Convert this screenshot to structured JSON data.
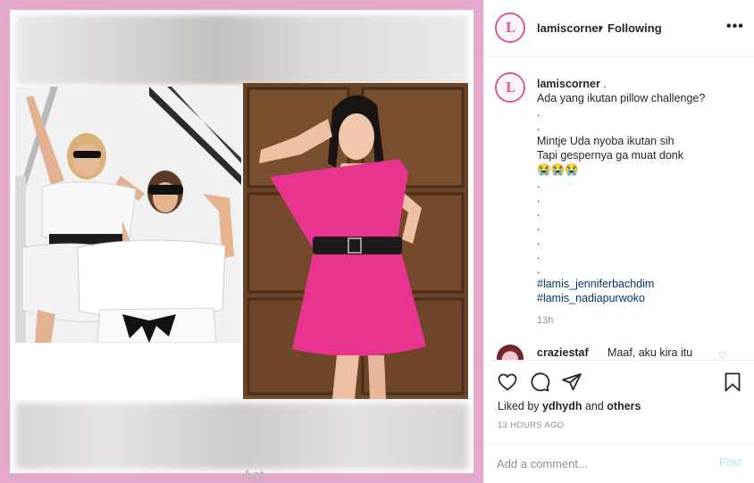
{
  "header": {
    "username": "lamiscorner",
    "separator": "•",
    "follow_status": "Following",
    "more_label": "•••",
    "avatar_letter": "L"
  },
  "caption": {
    "username": "lamiscorner",
    "after_username": " .",
    "lines": [
      "Ada yang ikutan pillow challenge?",
      ".",
      ".",
      "Mintje Uda nyoba ikutan sih",
      "Tapi gespernya ga muat donk",
      "😭😭😭",
      ".",
      ".",
      ".",
      ".",
      ".",
      ".",
      "."
    ],
    "hashtags": [
      "#lamis_jenniferbachdim",
      "#lamis_nadiapurwoko"
    ],
    "time": "13h"
  },
  "comment": {
    "username": "craziestaf",
    "text": "Maaf, aku kira itu",
    "heart": "♡"
  },
  "likes": {
    "prefix": "Liked by ",
    "user": "ydhydh",
    "middle": " and ",
    "others": "others"
  },
  "timestamp": "13 HOURS AGO",
  "add_comment": {
    "placeholder": "Add a comment...",
    "post_label": "Post"
  },
  "watermark": "Act",
  "colors": {
    "frame_pink": "#e4a8cd",
    "dress_pink": "#e8338f",
    "hashtag_blue": "#00376b",
    "post_disabled": "#b2dffc"
  },
  "icons": [
    "heart-icon",
    "comment-icon",
    "share-icon",
    "bookmark-icon",
    "more-icon"
  ]
}
